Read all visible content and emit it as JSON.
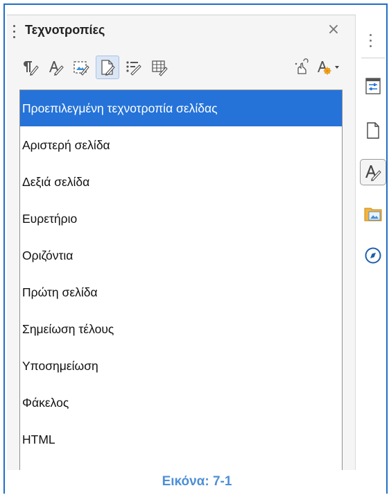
{
  "panel": {
    "title": "Τεχνοτροπίες",
    "close_label": "×"
  },
  "toolbar": {
    "buttons": [
      {
        "name": "paragraph-styles",
        "icon": "paragraph-styles-icon",
        "active": false
      },
      {
        "name": "character-styles",
        "icon": "character-styles-icon",
        "active": false
      },
      {
        "name": "frame-styles",
        "icon": "frame-styles-icon",
        "active": false
      },
      {
        "name": "page-styles",
        "icon": "page-styles-icon",
        "active": true
      },
      {
        "name": "list-styles",
        "icon": "list-styles-icon",
        "active": false
      },
      {
        "name": "table-styles",
        "icon": "table-styles-icon",
        "active": false
      },
      {
        "name": "fill-format-mode",
        "icon": "fill-format-icon",
        "active": false
      },
      {
        "name": "styles-actions",
        "icon": "styles-actions-icon",
        "active": false
      }
    ]
  },
  "styles_list": {
    "items": [
      "Προεπιλεγμένη τεχνοτροπία σελίδας",
      "Αριστερή σελίδα",
      "Δεξιά σελίδα",
      "Ευρετήριο",
      "Οριζόντια",
      "Πρώτη σελίδα",
      "Σημείωση τέλους",
      "Υποσημείωση",
      "Φάκελος",
      "HTML"
    ],
    "selected": "Προεπιλεγμένη τεχνοτροπία σελίδας"
  },
  "sidebar": {
    "buttons": [
      {
        "name": "properties",
        "icon": "properties-icon",
        "active": false
      },
      {
        "name": "page",
        "icon": "page-icon",
        "active": false
      },
      {
        "name": "styles",
        "icon": "styles-icon",
        "active": true
      },
      {
        "name": "gallery",
        "icon": "gallery-icon",
        "active": false
      },
      {
        "name": "navigator",
        "icon": "navigator-icon",
        "active": false
      }
    ]
  },
  "caption": "Εικόνα: 7-1",
  "colors": {
    "selection": "#2573d9",
    "frame": "#1f6fc4",
    "caption": "#4e8fd6"
  }
}
